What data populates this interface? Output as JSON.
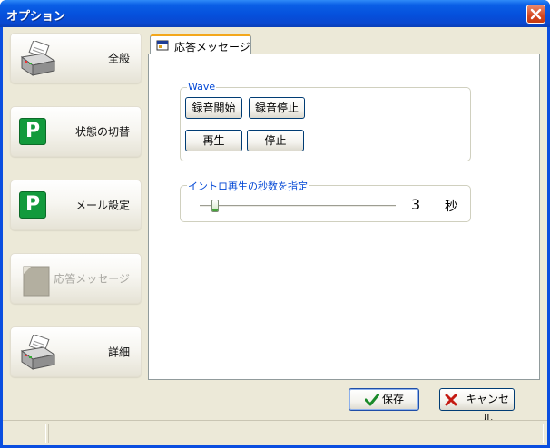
{
  "window": {
    "title": "オプション"
  },
  "sidebar": {
    "items": [
      {
        "label": "全般",
        "icon": "printer-icon",
        "enabled": true
      },
      {
        "label": "状態の切替",
        "icon": "green-p-icon",
        "enabled": true
      },
      {
        "label": "メール設定",
        "icon": "green-p-icon",
        "enabled": true
      },
      {
        "label": "応答メッセージ",
        "icon": "gray-document-icon",
        "enabled": false
      },
      {
        "label": "詳細",
        "icon": "printer-icon",
        "enabled": true
      }
    ]
  },
  "tab": {
    "label": "応答メッセージ"
  },
  "wave_group": {
    "legend": "Wave",
    "record_start": "録音開始",
    "record_stop": "録音停止",
    "play": "再生",
    "stop": "停止"
  },
  "intro_group": {
    "legend": "イントロ再生の秒数を指定",
    "value": "3",
    "unit": "秒",
    "slider_level": 0.07
  },
  "footer": {
    "save": "保存",
    "cancel": "キャンセル"
  },
  "colors": {
    "titlebar": "#0550dc",
    "accent_green": "#129a3c",
    "legend_blue": "#0046d5",
    "close_red": "#d4471f"
  }
}
